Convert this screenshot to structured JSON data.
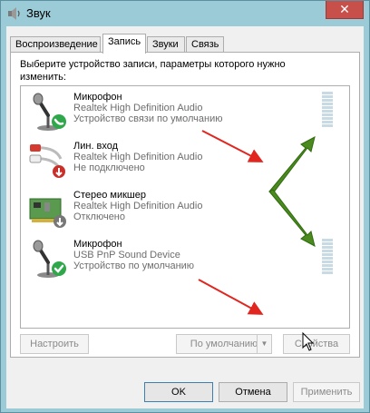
{
  "window": {
    "title": "Звук",
    "close_glyph": "✕"
  },
  "tabs": [
    {
      "label": "Воспроизведение",
      "active": false
    },
    {
      "label": "Запись",
      "active": true
    },
    {
      "label": "Звуки",
      "active": false
    },
    {
      "label": "Связь",
      "active": false
    }
  ],
  "instruction": "Выберите устройство записи, параметры которого нужно изменить:",
  "devices": [
    {
      "name": "Микрофон",
      "driver": "Realtek High Definition Audio",
      "status": "Устройство связи по умолчанию",
      "icon": "microphone-icon",
      "badge": "phone-badge",
      "level": 0,
      "meter": true
    },
    {
      "name": "Лин. вход",
      "driver": "Realtek High Definition Audio",
      "status": "Не подключено",
      "icon": "rca-cable-icon",
      "badge": "disconnected-badge",
      "meter": false
    },
    {
      "name": "Стерео микшер",
      "driver": "Realtek High Definition Audio",
      "status": "Отключено",
      "icon": "sound-card-icon",
      "badge": "disabled-badge",
      "meter": false
    },
    {
      "name": "Микрофон",
      "driver": "USB PnP Sound Device",
      "status": "Устройство по умолчанию",
      "icon": "microphone-icon",
      "badge": "checkmark-badge",
      "level": 0,
      "meter": true
    }
  ],
  "buttons": {
    "configure": "Настроить",
    "set_default": "По умолчанию",
    "properties": "Свойства",
    "ok": "OK",
    "cancel": "Отмена",
    "apply": "Применить"
  },
  "colors": {
    "annotation_red": "#e0261f",
    "annotation_green": "#4b8a1e",
    "phone_badge": "#2ea84a",
    "check_badge": "#2ea84a",
    "disconnected_badge": "#c8302a"
  }
}
